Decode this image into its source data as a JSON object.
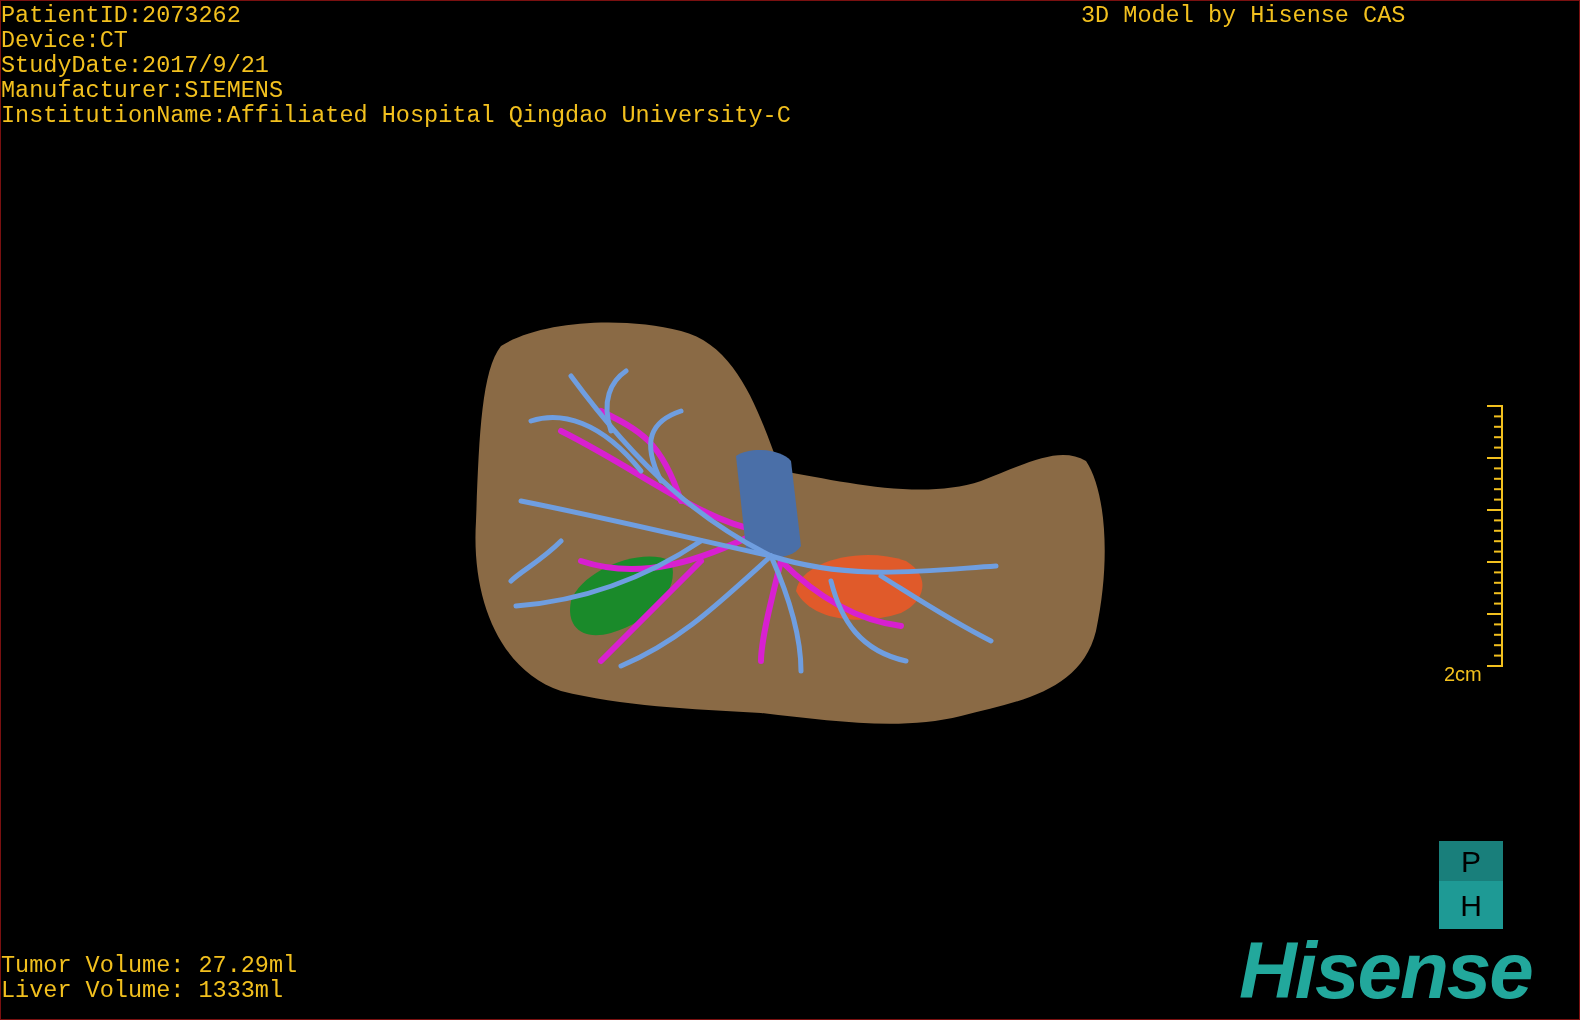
{
  "patient_info": [
    "PatientID:2073262",
    "Device:CT",
    "StudyDate:2017/9/21",
    "Manufacturer:SIEMENS",
    "InstitutionName:Affiliated Hospital Qingdao University-C"
  ],
  "title": "3D Model by Hisense CAS",
  "scale_bar": {
    "label": "2cm"
  },
  "volumes": [
    "Tumor Volume: 27.29ml",
    "Liver Volume: 1333ml"
  ],
  "logo": {
    "badge_letters": [
      "P",
      "H"
    ],
    "wordmark": "Hisense"
  }
}
